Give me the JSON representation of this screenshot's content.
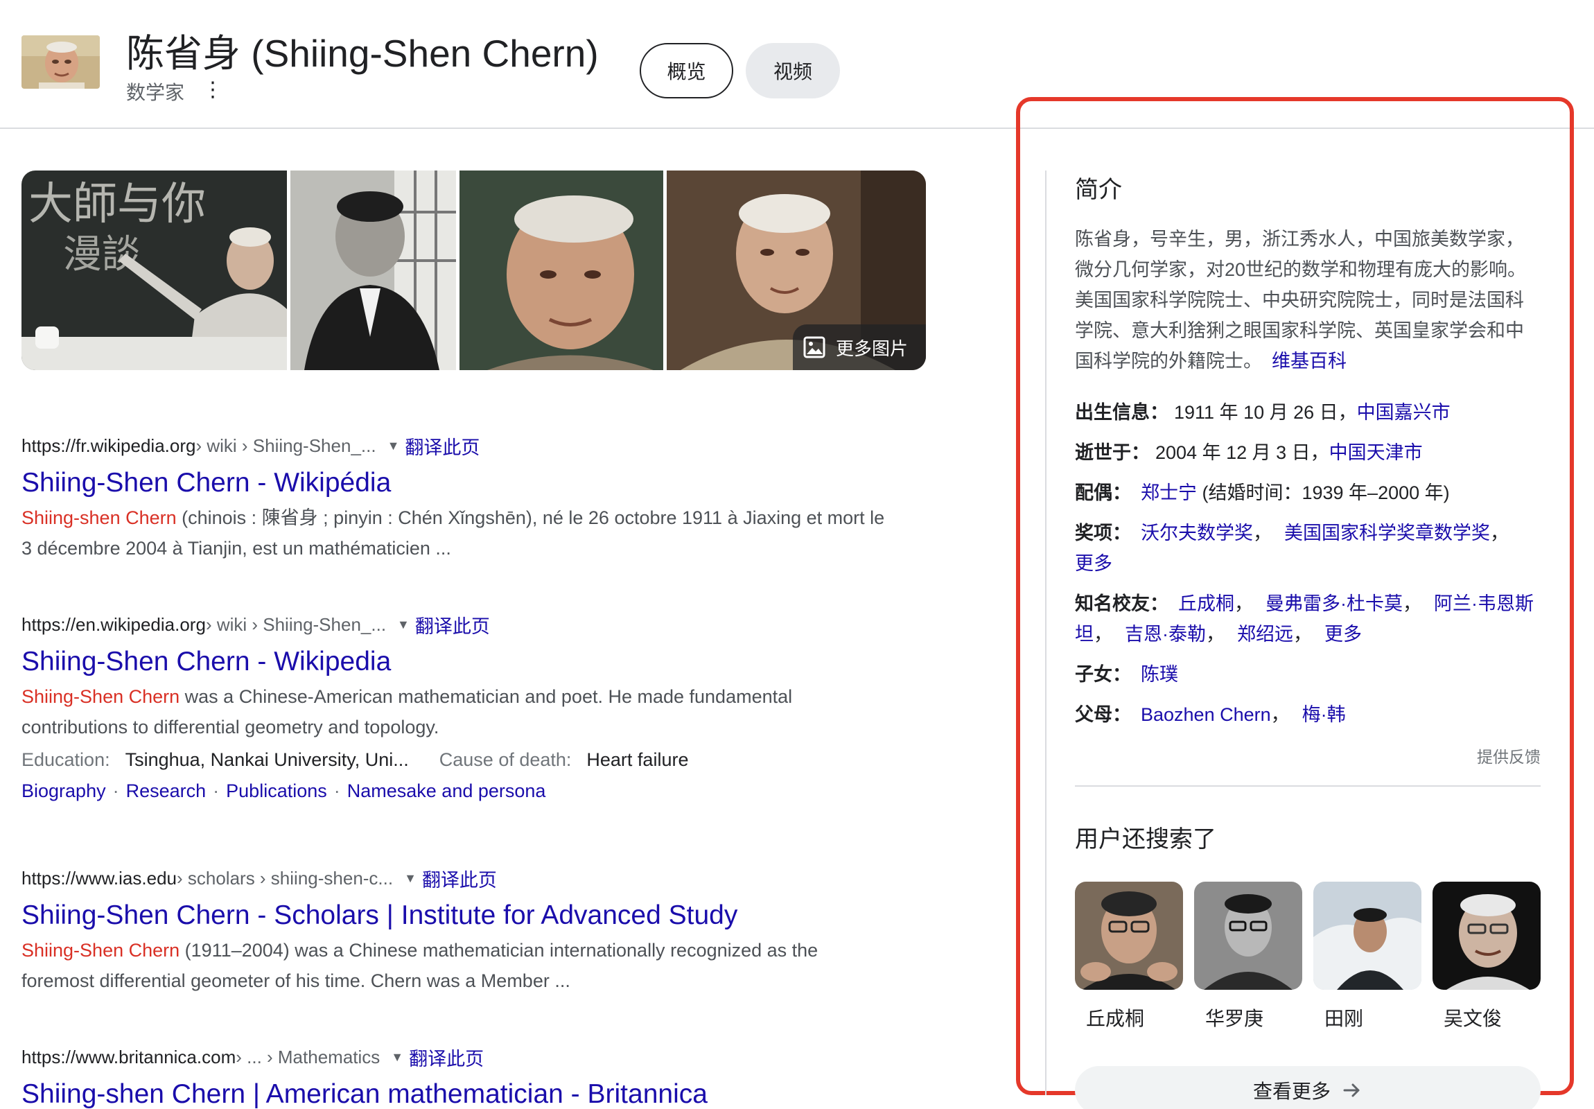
{
  "header": {
    "title": "陈省身 (Shiing-Shen Chern)",
    "subtitle": "数学家",
    "more_icon": "⋮",
    "tabs": [
      {
        "label": "概览",
        "selected": true
      },
      {
        "label": "视频",
        "selected": false
      }
    ]
  },
  "images": {
    "more_label": "更多图片"
  },
  "results": [
    {
      "url": "https://fr.wikipedia.org",
      "path": " › wiki › Shiing-Shen_...",
      "translate": "翻译此页",
      "title": "Shiing-Shen Chern - Wikipédia",
      "highlight": "Shiing-shen Chern",
      "snippet": " (chinois : 陳省身 ; pinyin : Chén Xǐngshēn), né le 26 octobre 1911 à Jiaxing et mort le 3 décembre 2004 à Tianjin, est un mathématicien ..."
    },
    {
      "url": "https://en.wikipedia.org",
      "path": " › wiki › Shiing-Shen_...",
      "translate": "翻译此页",
      "title": "Shiing-Shen Chern - Wikipedia",
      "highlight": "Shiing-Shen Chern",
      "snippet": " was a Chinese-American mathematician and poet. He made fundamental contributions to differential geometry and topology.",
      "facts": [
        {
          "label": "Education:",
          "value": "Tsinghua, Nankai University, Uni..."
        },
        {
          "label": "Cause of death:",
          "value": "Heart failure"
        }
      ],
      "links": [
        "Biography",
        "Research",
        "Publications",
        "Namesake and persona"
      ]
    },
    {
      "url": "https://www.ias.edu",
      "path": " › scholars › shiing-shen-c...",
      "translate": "翻译此页",
      "title": "Shiing-Shen Chern - Scholars | Institute for Advanced Study",
      "highlight": "Shiing-Shen Chern",
      "snippet": " (1911–2004) was a Chinese mathematician internationally recognized as the foremost differential geometer of his time. Chern was a Member ..."
    },
    {
      "url": "https://www.britannica.com",
      "path": " › ... › Mathematics",
      "translate": "翻译此页",
      "title": "Shiing-shen Chern | American mathematician - Britannica"
    }
  ],
  "panel": {
    "heading": "简介",
    "description": "陈省身，号辛生，男，浙江秀水人，中国旅美数学家，微分几何学家，对20世纪的数学和物理有庞大的影响。美国国家科学院院士、中央研究院院士，同时是法国科学院、意大利猞猁之眼国家科学院、英国皇家学会和中国科学院的外籍院士。",
    "source": "维基百科",
    "born_label": "出生信息：",
    "born_text": "1911 年 10 月 26 日，",
    "born_place": "中国嘉兴市",
    "died_label": "逝世于：",
    "died_text": "2004 年 12 月 3 日，",
    "died_place": "中国天津市",
    "spouse_label": "配偶：",
    "spouse": "郑士宁",
    "spouse_note": " (结婚时间：1939 年–2000 年)",
    "awards_label": "奖项：",
    "awards": [
      "沃尔夫数学奖",
      "美国国家科学奖章数学奖",
      "更多"
    ],
    "alumni_label": "知名校友：",
    "alumni": [
      "丘成桐",
      "曼弗雷多·杜卡莫",
      "阿兰·韦恩斯坦",
      "吉恩·泰勒",
      "郑绍远",
      "更多"
    ],
    "children_label": "子女：",
    "children": "陈璞",
    "parents_label": "父母：",
    "parents": [
      "Baozhen Chern",
      "梅·韩"
    ],
    "feedback": "提供反馈",
    "people_heading": "用户还搜索了",
    "people": [
      {
        "name": "丘成桐"
      },
      {
        "name": "华罗庚"
      },
      {
        "name": "田刚"
      },
      {
        "name": "吴文俊"
      }
    ],
    "see_more": "查看更多",
    "frame_color": "#e5382a"
  },
  "colors": {
    "link": "#1a0dab",
    "highlight": "#d93025",
    "snippet": "#4d5156"
  }
}
